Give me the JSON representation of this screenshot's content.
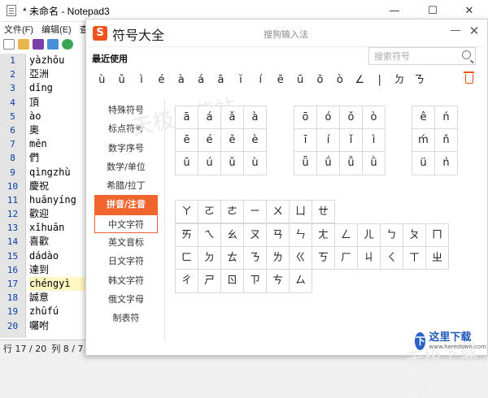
{
  "notepad": {
    "title": "* 未命名 - Notepad3",
    "window_controls": {
      "minimize": "—",
      "maximize": "☐",
      "close": "✕"
    },
    "menu": [
      "文件(F)",
      "编辑(E)",
      "查"
    ],
    "lines": [
      "1",
      "2",
      "3",
      "4",
      "5",
      "6",
      "7",
      "8",
      "9",
      "10",
      "11",
      "12",
      "13",
      "14",
      "15",
      "16",
      "17",
      "18",
      "19",
      "20"
    ],
    "text": [
      "yàzhōu",
      "亞洲",
      "dǐng",
      "頂",
      "ào",
      "奧",
      "mēn",
      "們",
      "qìngzhù",
      "慶祝",
      "huānyíng",
      "歡迎",
      "xǐhuān",
      "喜歡",
      "dádào",
      "達到",
      "chéngyì",
      "誠意",
      "zhūfú",
      "囑咐"
    ],
    "current_line_index": 16,
    "status": {
      "row": "行 17 / 20",
      "col": "列 8 / 7"
    }
  },
  "dialog": {
    "logo": "S",
    "name": "符号大全",
    "subtitle": "搜狗输入法",
    "minimize": "—",
    "close": "✕",
    "recent_label": "最近使用",
    "search_placeholder": "搜索符号",
    "recent_symbols": [
      "ù",
      "ǔ",
      "ì",
      "é",
      "à",
      "á",
      "ā",
      "ĭ",
      "í",
      "ē",
      "ū",
      "ō",
      "ò",
      "∠",
      "|",
      "ㄉ",
      "ㄋ"
    ],
    "categories": [
      "特殊符号",
      "标点符号",
      "数字序号",
      "数学/单位",
      "希腊/拉丁",
      "拼音/注音",
      "中文字符",
      "英文音标",
      "日文字符",
      "韩文字符",
      "俄文字母",
      "制表符"
    ],
    "active_category": "拼音/注音",
    "selected_category": "中文字符",
    "pinyin_a": [
      "ā",
      "á",
      "ǎ",
      "à",
      "ē",
      "é",
      "ě",
      "è",
      "ū",
      "ú",
      "ǔ",
      "ù"
    ],
    "pinyin_o": [
      "ō",
      "ó",
      "ǒ",
      "ò",
      "ī",
      "í",
      "ǐ",
      "ì",
      "ǖ",
      "ǘ",
      "ǚ",
      "ǜ"
    ],
    "pinyin_e": [
      "ê",
      "ń",
      "ḿ",
      "ň",
      "ü",
      "ǹ"
    ],
    "zhuyin_row1": [
      "ㄚ",
      "ㄛ",
      "ㄜ",
      "ㄧ",
      "ㄨ",
      "ㄩ",
      "ㄝ"
    ],
    "zhuyin_rows": [
      "ㄞ",
      "ㄟ",
      "ㄠ",
      "ㄡ",
      "ㄢ",
      "ㄣ",
      "ㄤ",
      "ㄥ",
      "ㄦ",
      "ㄅ",
      "ㄆ",
      "ㄇ",
      "ㄈ",
      "ㄉ",
      "ㄊ",
      "ㄋ",
      "ㄌ",
      "ㄍ",
      "ㄎ",
      "ㄏ",
      "ㄐ",
      "ㄑ",
      "ㄒ",
      "ㄓ",
      "ㄔ",
      "ㄕ",
      "ㄖ",
      "ㄗ",
      "ㄘ",
      "ㄙ"
    ],
    "watermark": "天极下载站"
  },
  "brand": {
    "icon": "下",
    "name": "这里下载",
    "url": "www.heredown.com"
  },
  "colors": {
    "accent": "#f0652d",
    "line_numbers": "#0a3ea8"
  }
}
